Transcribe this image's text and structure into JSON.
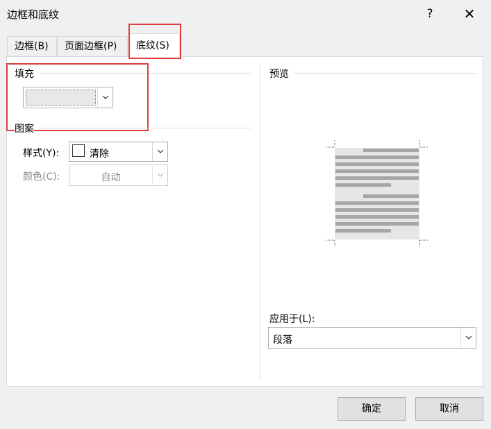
{
  "window": {
    "title": "边框和底纹",
    "help": "?",
    "close": "✕"
  },
  "tabs": [
    {
      "label": "边框(B)",
      "active": false
    },
    {
      "label": "页面边框(P)",
      "active": false
    },
    {
      "label": "底纹(S)",
      "active": true
    }
  ],
  "fill": {
    "group_label": "填充",
    "value": ""
  },
  "pattern": {
    "group_label": "图案",
    "style_label": "样式(Y):",
    "style_value": "清除",
    "color_label": "颜色(C):",
    "color_value": "自动"
  },
  "preview": {
    "group_label": "预览"
  },
  "apply": {
    "label": "应用于(L):",
    "value": "段落"
  },
  "buttons": {
    "ok": "确定",
    "cancel": "取消"
  },
  "colors": {
    "highlight": "#d9403f",
    "preview_fill": "#e6e6e6",
    "preview_lines": "#a6a6a6"
  }
}
